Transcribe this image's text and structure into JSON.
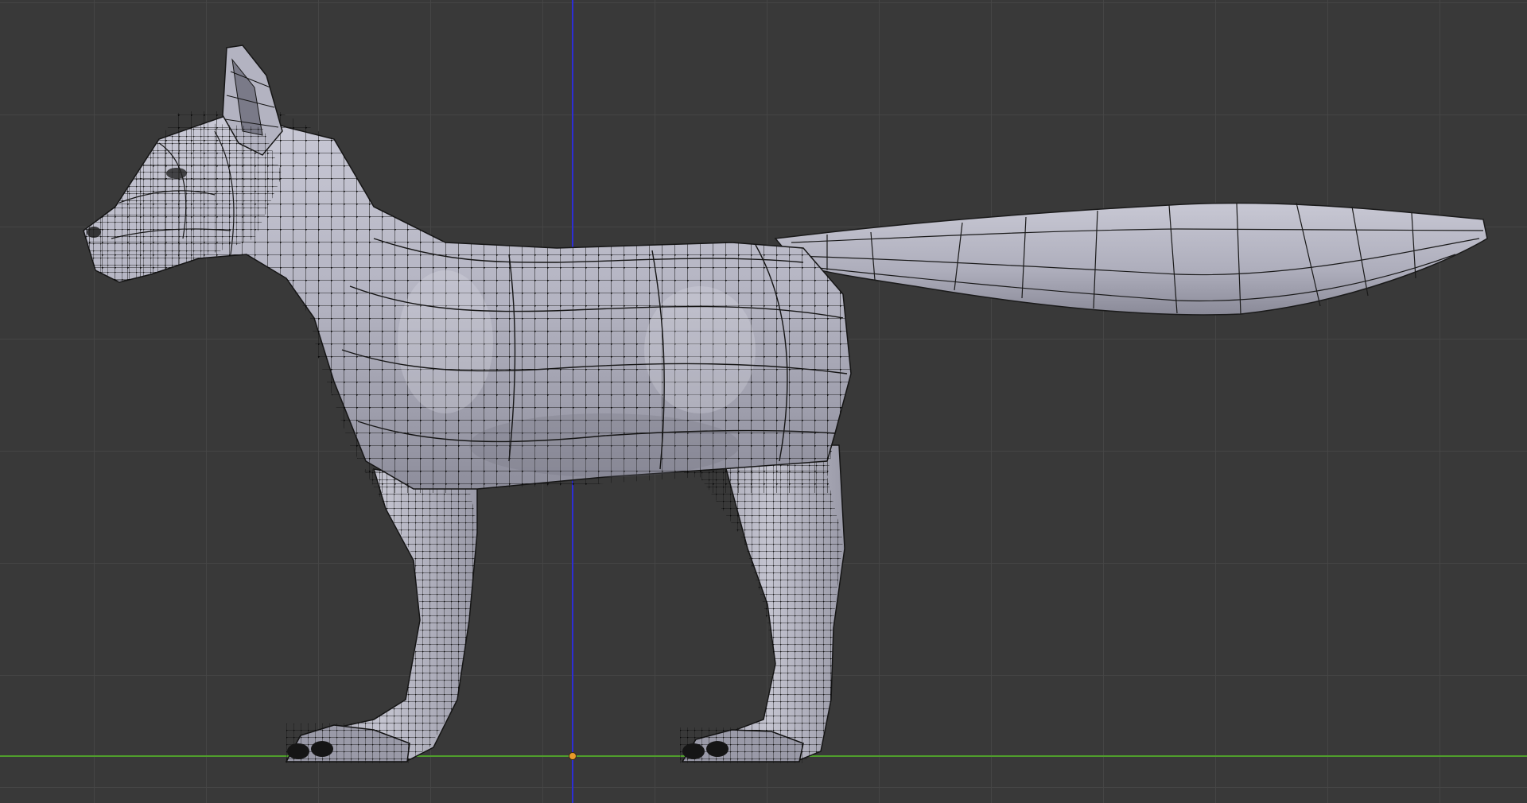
{
  "viewport": {
    "mode": "edit-mode-side-ortho",
    "object": "fox-mesh",
    "background_color": "#393939",
    "grid_color": "#464646",
    "x_axis_color": "#55a02a",
    "z_axis_color": "#2a2ad8",
    "origin_color": "#e89a2a",
    "mesh_color": "#b9b9c8",
    "wire_color": "#111111"
  }
}
